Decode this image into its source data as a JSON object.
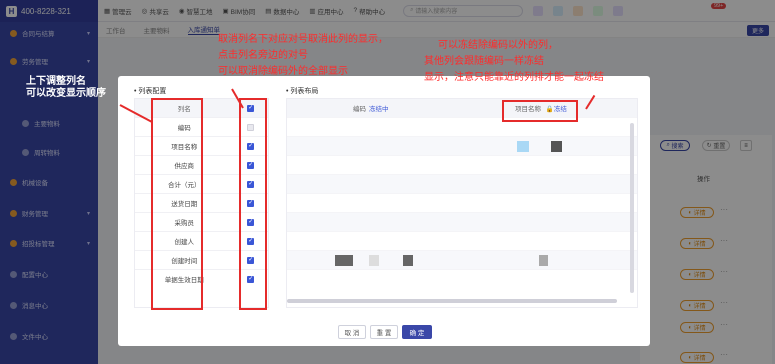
{
  "sidebar": {
    "phone": "400-8228-321",
    "items": [
      {
        "label": "合同与结算",
        "sub": false
      },
      {
        "label": "劳务管理",
        "sub": false
      },
      {
        "label": "主要物料",
        "sub": true
      },
      {
        "label": "周转物料",
        "sub": true
      },
      {
        "label": "机械设备",
        "sub": false
      },
      {
        "label": "财务管理",
        "sub": false
      },
      {
        "label": "招投标管理",
        "sub": false
      },
      {
        "label": "配置中心",
        "sub": false
      },
      {
        "label": "消息中心",
        "sub": false
      },
      {
        "label": "文件中心",
        "sub": false
      }
    ]
  },
  "topbar": {
    "items": [
      "管理云",
      "共享云",
      "智慧工地",
      "BIM协同",
      "数据中心",
      "应用中心",
      "帮助中心"
    ],
    "search_placeholder": "请输入搜索内容",
    "badge": "99+"
  },
  "tabs": {
    "items": [
      "工作台",
      "主要物料",
      "入库通知单"
    ],
    "active_index": 2,
    "more_label": "更多"
  },
  "background": {
    "search_label": "搜索",
    "reset_label": "重置",
    "menu_label": "≡",
    "operation_header": "操作",
    "detail_label": "详情",
    "dots": "···"
  },
  "modal": {
    "left_title": "列表配置",
    "right_title": "列表布局",
    "left_table": {
      "header": "列名",
      "rows": [
        {
          "name": "编码",
          "checked": false
        },
        {
          "name": "项目名称",
          "checked": true
        },
        {
          "name": "供应商",
          "checked": true
        },
        {
          "name": "合计（元）",
          "checked": true
        },
        {
          "name": "送货日期",
          "checked": true
        },
        {
          "name": "采购员",
          "checked": true
        },
        {
          "name": "创建人",
          "checked": true
        },
        {
          "name": "创建时间",
          "checked": true
        },
        {
          "name": "单据生效日期",
          "checked": true
        }
      ]
    },
    "right_table": {
      "code_header": "编码",
      "code_freeze": "冻结中",
      "project_header": "项目名称",
      "project_freeze": "冻结"
    },
    "buttons": {
      "cancel": "取 消",
      "reset": "重 置",
      "confirm": "确 定"
    }
  },
  "annotations": {
    "left_line1": "上下调整列名",
    "left_line2": "可以改变显示顺序",
    "mid_line1": "取消列名下对应对号取消此列的显示，",
    "mid_line2": "点击列名旁边的对号",
    "mid_line3": "可以取消除编码外的全部显示",
    "right_line1": "可以冻结除编码以外的列，",
    "right_line2": "其他列会跟随编码一样冻结",
    "right_line3": "显示，注意只能靠近的列排才能一起冻结"
  },
  "colors": {
    "brand": "#3a47a8",
    "annotation_red": "#e52b2b",
    "check_blue": "#3a56d6",
    "detail_orange": "#f0a030"
  }
}
